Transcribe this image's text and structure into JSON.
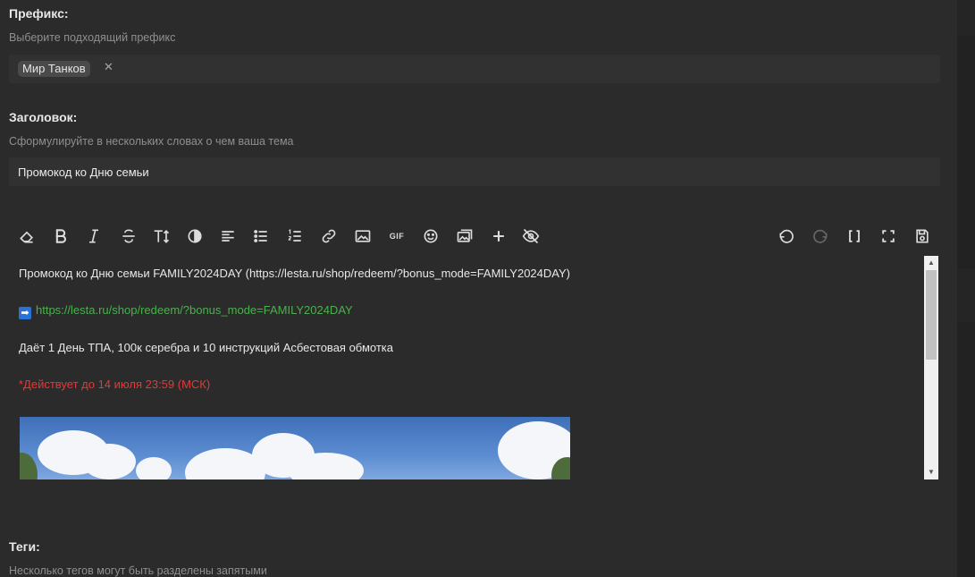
{
  "prefix": {
    "label": "Префикс:",
    "hint": "Выберите подходящий префикс",
    "chip": "Мир Танков",
    "chip_remove": "✕"
  },
  "title": {
    "label": "Заголовок:",
    "hint": "Сформулируйте в нескольких словах о чем ваша тема",
    "value": "Промокод ко Дню семьи"
  },
  "toolbar": {
    "left_icons": [
      "eraser-icon",
      "bold-icon",
      "italic-icon",
      "strikethrough-icon",
      "text-size-icon",
      "contrast-icon",
      "align-left-icon",
      "bullet-list-icon",
      "numbered-list-icon",
      "link-icon",
      "image-icon",
      "gif-icon",
      "emoji-icon",
      "media-gallery-icon",
      "plus-icon",
      "hide-icon"
    ],
    "right_icons": [
      "undo-icon",
      "redo-icon",
      "brackets-icon",
      "fullscreen-icon",
      "save-icon"
    ],
    "gif_label": "GIF"
  },
  "editor": {
    "line1": "Промокод ко Дню семьи FAMILY2024DAY (https://lesta.ru/shop/redeem/?bonus_mode=FAMILY2024DAY)",
    "arrow": "➡",
    "link": "https://lesta.ru/shop/redeem/?bonus_mode=FAMILY2024DAY",
    "line3": "Даёт 1 День ТПА, 100к серебра и 10 инструкций Асбестовая обмотка",
    "line4": "*Действует до 14 июля 23:59 (МСК)",
    "scroll_up": "▲",
    "scroll_down": "▼"
  },
  "tags": {
    "label": "Теги:",
    "hint": "Несколько тегов могут быть разделены запятыми"
  },
  "colors": {
    "background": "#2b2b2b",
    "field": "#313131",
    "link": "#4caf50",
    "warning": "#e53935"
  }
}
